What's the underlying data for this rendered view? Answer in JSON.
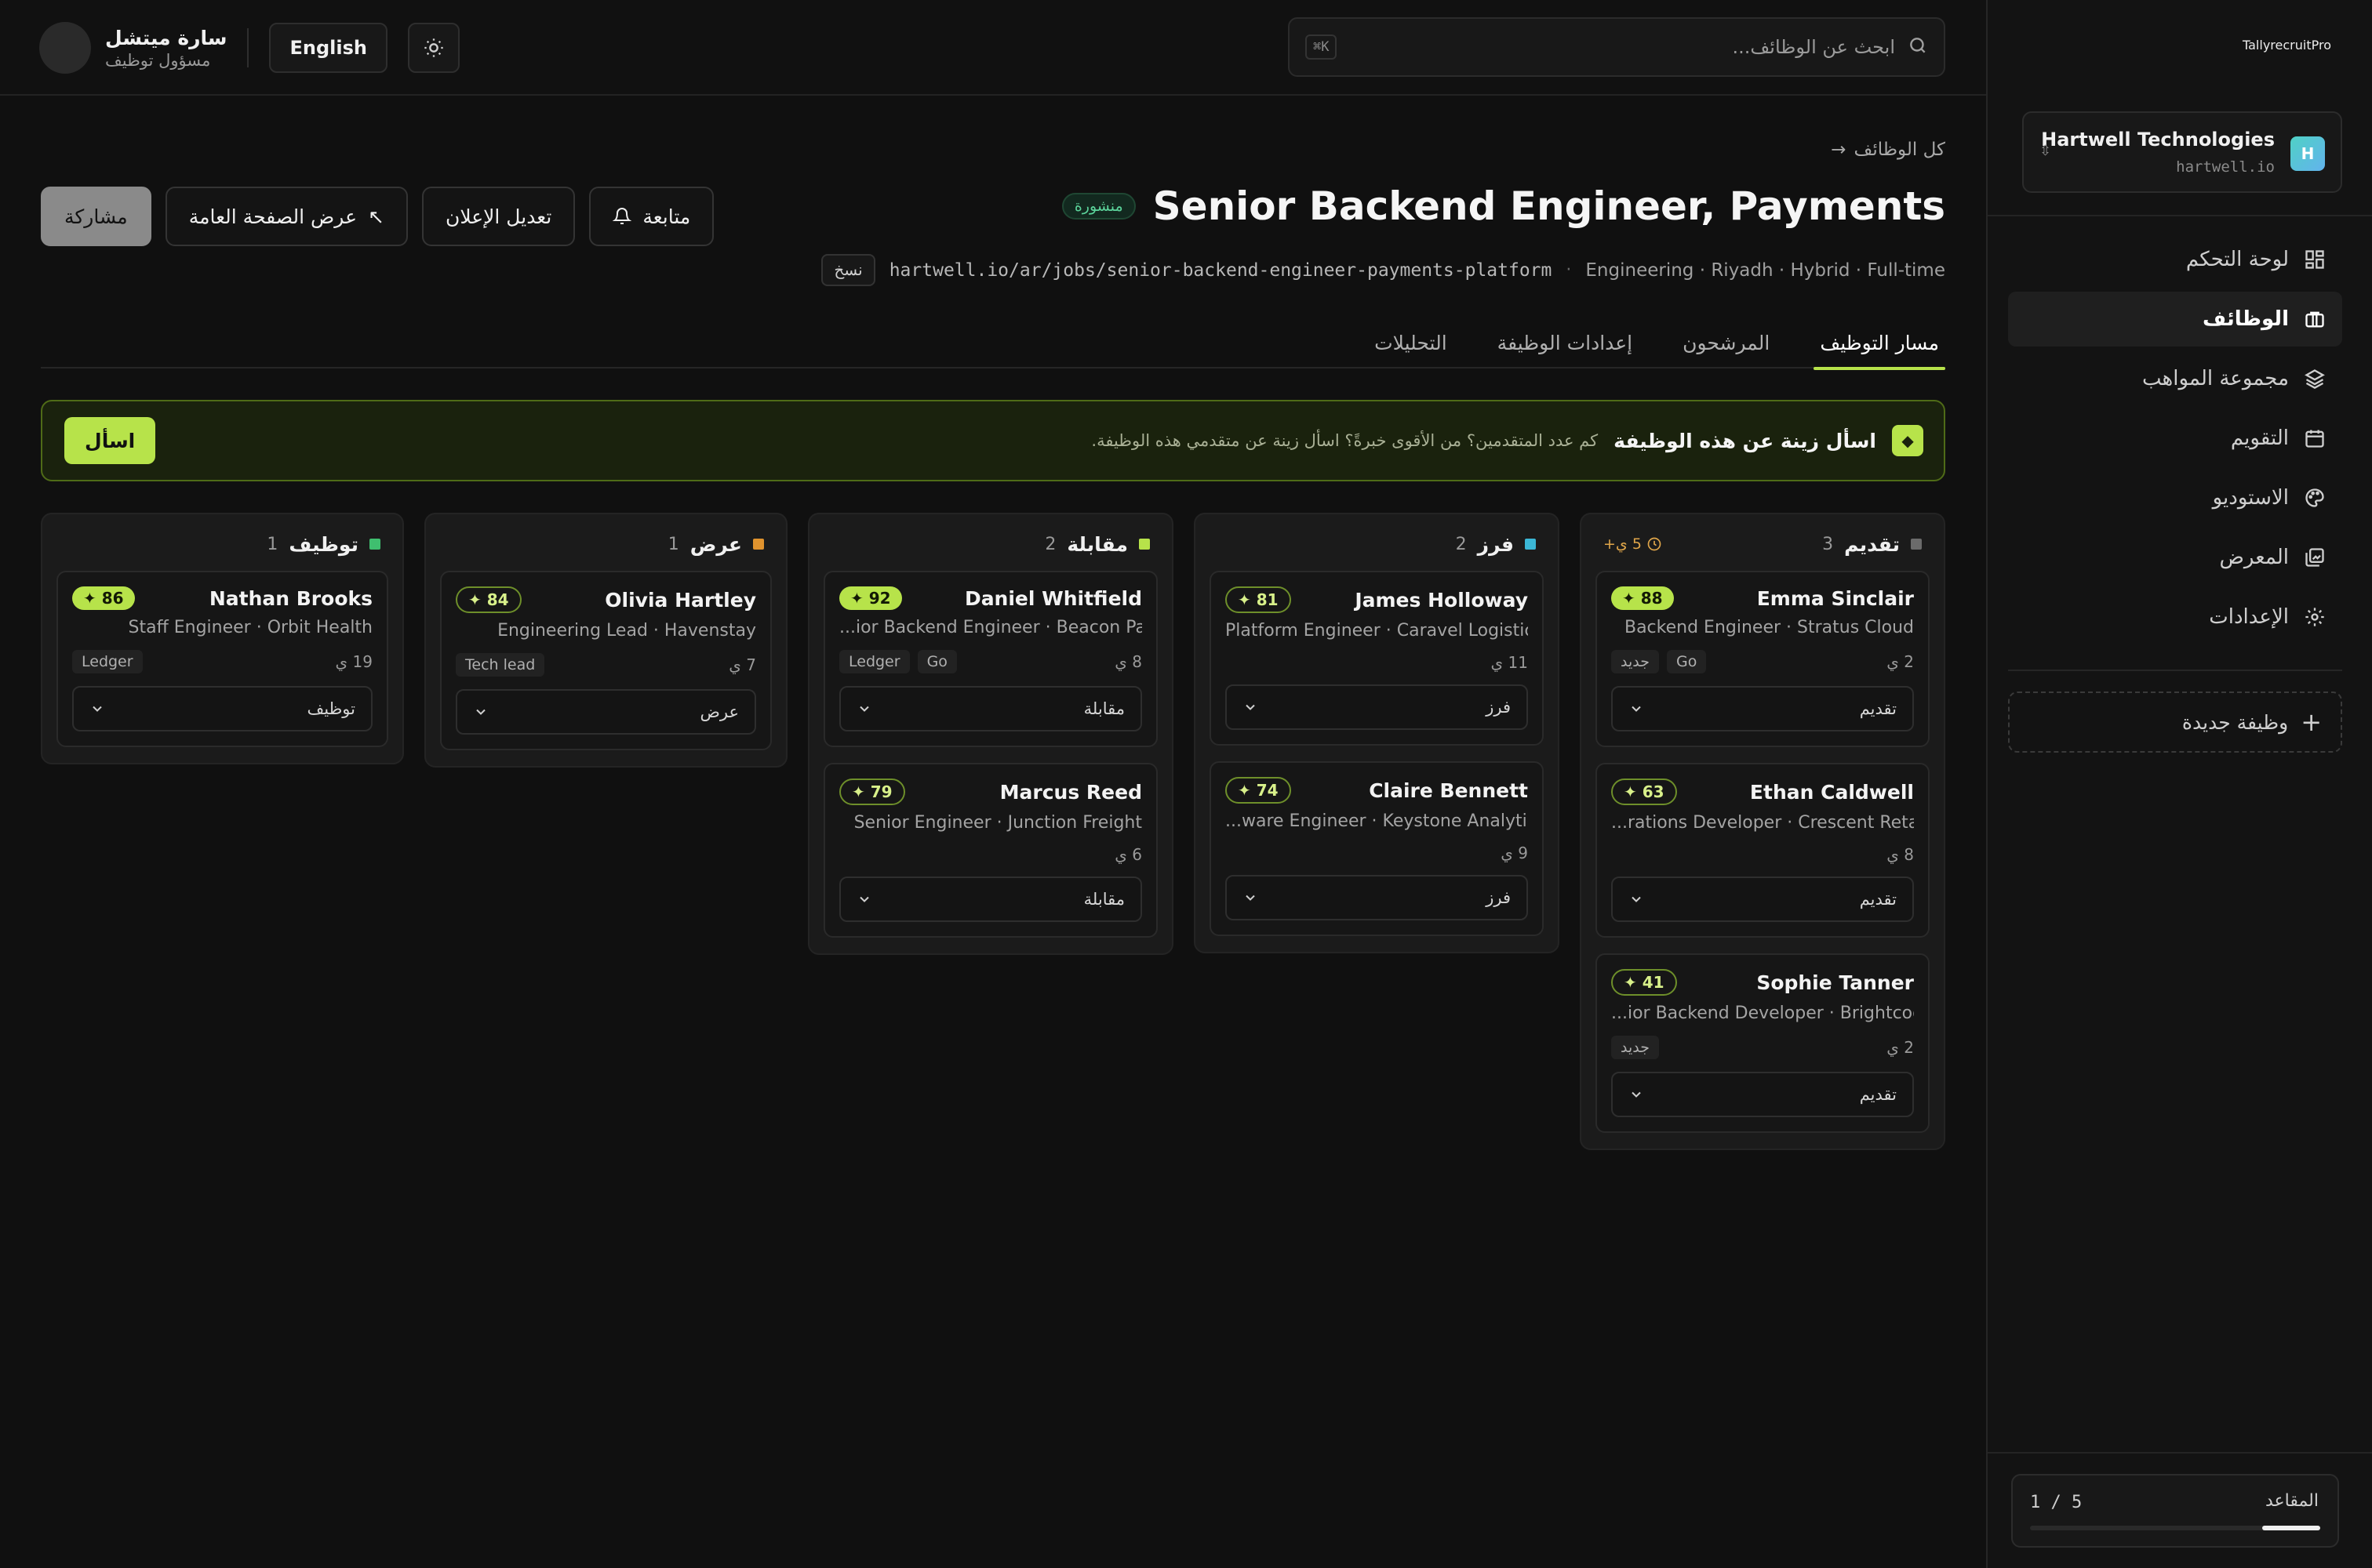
{
  "brand": {
    "part1": "Tally",
    "part2": "recruit",
    "part3": "Pro",
    "accent": "#b7e34a"
  },
  "workspace": {
    "initial": "H",
    "name": "Hartwell Technologies",
    "domain": "hartwell.io"
  },
  "nav": {
    "items": [
      {
        "label": "لوحة التحكم",
        "icon": "dashboard-icon"
      },
      {
        "label": "الوظائف",
        "icon": "briefcase-icon",
        "active": true
      },
      {
        "label": "مجموعة المواهب",
        "icon": "layers-icon"
      },
      {
        "label": "التقويم",
        "icon": "calendar-icon"
      },
      {
        "label": "الاستوديو",
        "icon": "palette-icon"
      },
      {
        "label": "المعرض",
        "icon": "gallery-icon"
      },
      {
        "label": "الإعدادات",
        "icon": "gear-icon"
      }
    ],
    "new_job": "وظيفة جديدة"
  },
  "seats": {
    "label": "المقاعد",
    "used": 1,
    "total": 5,
    "count_text": "1 / 5",
    "fraction": 0.2
  },
  "topbar": {
    "search_placeholder": "ابحث عن الوظائف...",
    "shortcut": "⌘K",
    "language": "English",
    "user_name": "سارة ميتشل",
    "user_role": "مسؤول توظيف"
  },
  "job": {
    "breadcrumb": "كل الوظائف",
    "breadcrumb_arrow": "→",
    "title": "Senior Backend Engineer, Payments",
    "status": "منشورة",
    "meta": "Engineering · Riyadh · Hybrid · Full-time",
    "url": "hartwell.io/ar/jobs/senior-backend-engineer-payments-platform",
    "copy": "نسخ",
    "actions": {
      "follow": "متابعة",
      "edit": "تعديل الإعلان",
      "view_public": "عرض الصفحة العامة",
      "share": "مشاركة"
    },
    "tabs": [
      "مسار التوظيف",
      "المرشحون",
      "إعدادات الوظيفة",
      "التحليلات"
    ]
  },
  "ai": {
    "title": "اسأل زينة عن هذه الوظيفة",
    "desc": "كم عدد المتقدمين؟ من الأقوى خبرةً؟ اسأل زينة عن متقدمي هذه الوظيفة.",
    "button": "اسأل"
  },
  "pipeline": [
    {
      "name": "تقديم",
      "count": "3",
      "color": "#6b6b6b",
      "sla": "5 ي+",
      "cards": [
        {
          "name": "Emma Sinclair",
          "score": "88",
          "level": "high",
          "role": "Backend Engineer · Stratus Cloud",
          "tags": [
            "Go",
            "جديد"
          ],
          "days": "2 ي",
          "stage": "تقديم"
        },
        {
          "name": "Ethan Caldwell",
          "score": "63",
          "level": "mid",
          "role": "...rations Developer · Crescent Retail",
          "tags": [],
          "days": "8 ي",
          "stage": "تقديم"
        },
        {
          "name": "Sophie Tanner",
          "score": "41",
          "level": "mid",
          "role": "...ior Backend Developer · Brightcode",
          "tags": [
            "جديد"
          ],
          "days": "2 ي",
          "stage": "تقديم"
        }
      ]
    },
    {
      "name": "فرز",
      "count": "2",
      "color": "#3bb7d6",
      "sla": "",
      "cards": [
        {
          "name": "James Holloway",
          "score": "81",
          "level": "mid",
          "role": "Platform Engineer · Caravel Logistics",
          "tags": [],
          "days": "11 ي",
          "stage": "فرز"
        },
        {
          "name": "Claire Bennett",
          "score": "74",
          "level": "mid",
          "role": "...ware Engineer · Keystone Analytics",
          "tags": [],
          "days": "9 ي",
          "stage": "فرز"
        }
      ]
    },
    {
      "name": "مقابلة",
      "count": "2",
      "color": "#b7e34a",
      "sla": "",
      "cards": [
        {
          "name": "Daniel Whitfield",
          "score": "92",
          "level": "high",
          "role": "...ior Backend Engineer · Beacon Pay",
          "tags": [
            "Go",
            "Ledger"
          ],
          "days": "8 ي",
          "stage": "مقابلة"
        },
        {
          "name": "Marcus Reed",
          "score": "79",
          "level": "mid",
          "role": "Senior Engineer · Junction Freight",
          "tags": [],
          "days": "6 ي",
          "stage": "مقابلة"
        }
      ]
    },
    {
      "name": "عرض",
      "count": "1",
      "color": "#e0932e",
      "sla": "",
      "cards": [
        {
          "name": "Olivia Hartley",
          "score": "84",
          "level": "mid",
          "role": "Engineering Lead · Havenstay",
          "tags": [
            "Tech lead"
          ],
          "days": "7 ي",
          "stage": "عرض"
        }
      ]
    },
    {
      "name": "توظيف",
      "count": "1",
      "color": "#3fbf6f",
      "sla": "",
      "cards": [
        {
          "name": "Nathan Brooks",
          "score": "86",
          "level": "high",
          "role": "Staff Engineer · Orbit Health",
          "tags": [
            "Ledger"
          ],
          "days": "19 ي",
          "stage": "توظيف"
        }
      ]
    }
  ]
}
